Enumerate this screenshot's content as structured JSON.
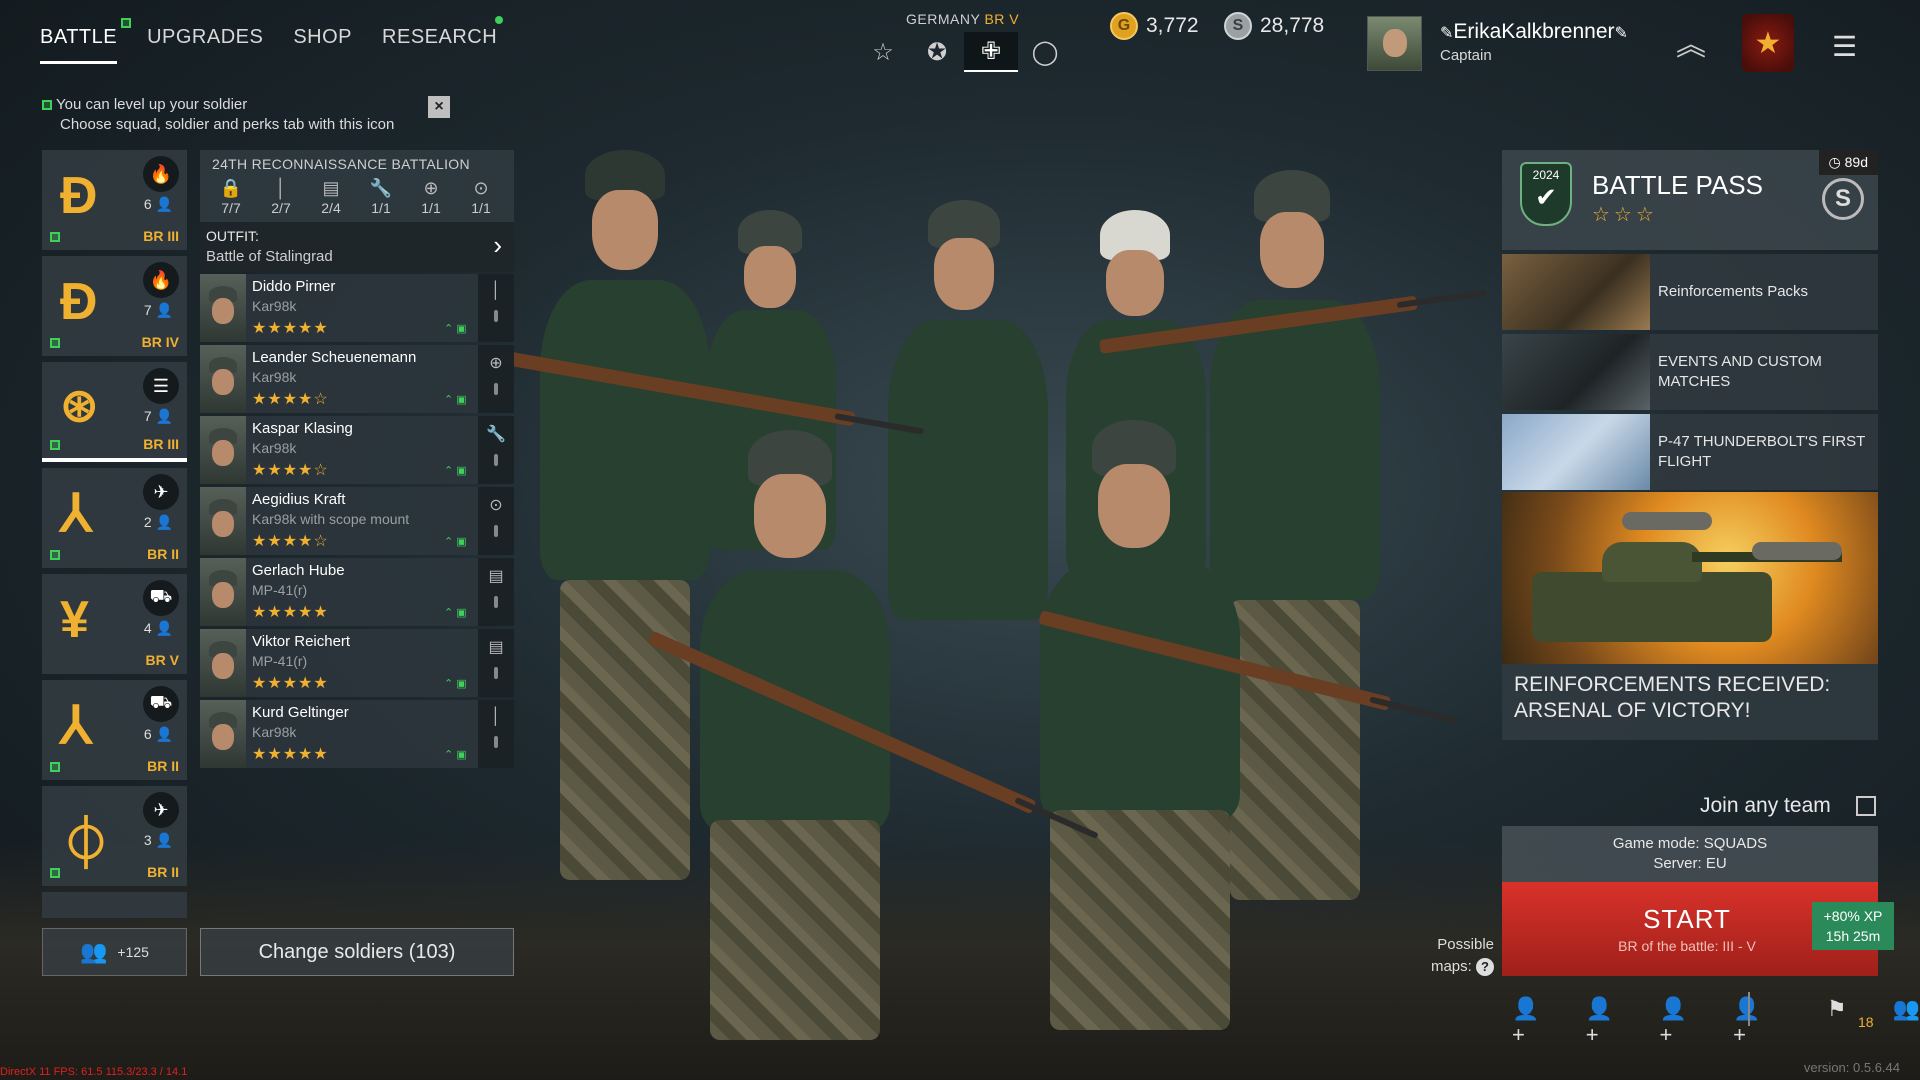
{
  "nav": {
    "tabs": [
      {
        "label": "BATTLE"
      },
      {
        "label": "UPGRADES"
      },
      {
        "label": "SHOP"
      },
      {
        "label": "RESEARCH"
      }
    ]
  },
  "hint": {
    "line1": "You can level up your soldier",
    "line2": "Choose squad, soldier and perks tab with this icon",
    "close": "×"
  },
  "faction": {
    "name": "GERMANY",
    "br": "BR V",
    "icons": [
      "star-outline-icon",
      "star-circle-icon",
      "iron-cross-icon",
      "circle-icon"
    ]
  },
  "currency": {
    "gold": "3,772",
    "silver": "28,778",
    "gold_symbol": "G",
    "silver_symbol": "S"
  },
  "profile": {
    "username": "ErikaKalkbrenner",
    "rank": "Captain"
  },
  "squads": [
    {
      "type_icon": "flame-icon",
      "count": "6",
      "br": "BR III"
    },
    {
      "type_icon": "flame-icon",
      "count": "7",
      "br": "BR IV"
    },
    {
      "type_icon": "list-icon",
      "count": "7",
      "br": "BR III"
    },
    {
      "type_icon": "plane-icon",
      "count": "2",
      "br": "BR II"
    },
    {
      "type_icon": "tank-icon",
      "count": "4",
      "br": "BR V"
    },
    {
      "type_icon": "tank-icon",
      "count": "6",
      "br": "BR II"
    },
    {
      "type_icon": "plane-icon",
      "count": "3",
      "br": "BR II"
    }
  ],
  "roster": {
    "battalion": "24TH RECONNAISSANCE BATTALION",
    "stats": [
      {
        "icon": "lock-icon",
        "value": "7/7"
      },
      {
        "icon": "rifle-icon",
        "value": "2/7"
      },
      {
        "icon": "radio-icon",
        "value": "2/4"
      },
      {
        "icon": "wrench-icon",
        "value": "1/1"
      },
      {
        "icon": "medic-icon",
        "value": "1/1"
      },
      {
        "icon": "crosshair-icon",
        "value": "1/1"
      }
    ],
    "outfit_label": "OUTFIT:",
    "outfit_value": "Battle of Stalingrad",
    "soldiers": [
      {
        "name": "Diddo Pirner",
        "weapon": "Kar98k",
        "stars": 5
      },
      {
        "name": "Leander Scheuenemann",
        "weapon": "Kar98k",
        "stars": 4
      },
      {
        "name": "Kaspar Klasing",
        "weapon": "Kar98k",
        "stars": 4
      },
      {
        "name": "Aegidius Kraft",
        "weapon": "Kar98k with scope mount",
        "stars": 4
      },
      {
        "name": "Gerlach Hube",
        "weapon": "MP-41(r)",
        "stars": 5
      },
      {
        "name": "Viktor Reichert",
        "weapon": "MP-41(r)",
        "stars": 5
      },
      {
        "name": "Kurd Geltinger",
        "weapon": "Kar98k",
        "stars": 5
      }
    ]
  },
  "bottom_left": {
    "squad_count": "+125",
    "change_soldiers": "Change soldiers (103)"
  },
  "battle_pass": {
    "title": "BATTLE PASS",
    "days": "89d",
    "emblem_year": "2024"
  },
  "promos": [
    {
      "label": "Reinforcements Packs"
    },
    {
      "label": "EVENTS AND CUSTOM MATCHES"
    },
    {
      "label": "P-47 THUNDERBOLT'S FIRST FLIGHT"
    }
  ],
  "feature": {
    "caption": "REINFORCEMENTS RECEIVED: ARSENAL OF VICTORY!"
  },
  "matchmaking": {
    "join_any_team": "Join any team",
    "game_mode": "Game mode: SQUADS",
    "server": "Server: EU",
    "start": "START",
    "br_range": "BR of the battle: III - V",
    "xp_bonus": "+80% XP",
    "xp_time": "15h 25m",
    "possible_maps": "Possible maps:",
    "help": "?",
    "player_count": "18"
  },
  "footer": {
    "debug": "DirectX 11 FPS: 61.5 115.3/23.3 / 14.1",
    "version": "version: 0.5.6.44"
  }
}
